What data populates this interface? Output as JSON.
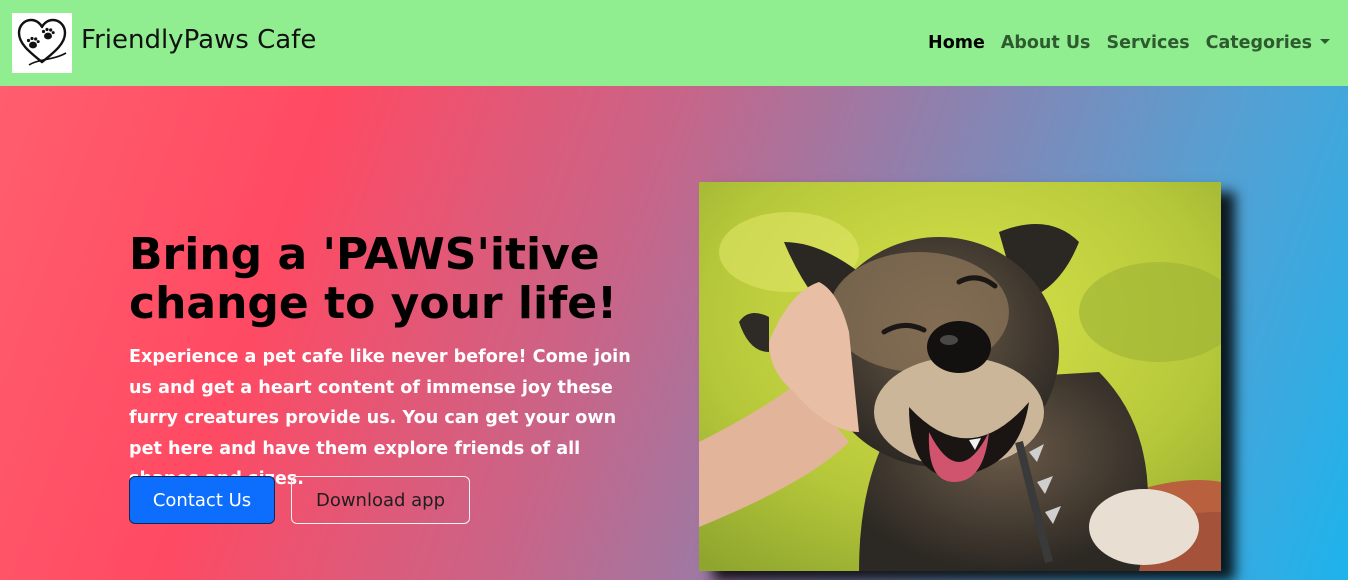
{
  "brand": {
    "name": "FriendlyPaws Cafe",
    "logo_icon": "heart-paw-logo-icon"
  },
  "nav": {
    "items": [
      {
        "label": "Home",
        "active": true
      },
      {
        "label": "About Us",
        "active": false
      },
      {
        "label": "Services",
        "active": false
      },
      {
        "label": "Categories",
        "active": false,
        "dropdown": true
      }
    ]
  },
  "hero": {
    "headline": "Bring a 'PAWS'itive change to your life!",
    "lead": "Experience a pet cafe like never before! Come join us and get a heart content of immense joy these furry creatures provide us. You can get your own pet here and have them explore friends of all shapes and sizes.",
    "primary_button": "Contact Us",
    "secondary_button": "Download app",
    "image_subject": "happy-dog-photo"
  },
  "colors": {
    "navbar": "#90ee90",
    "gradient_start": "#ff4a63",
    "gradient_end": "#1eb3ec",
    "primary_button": "#0d6efd"
  }
}
